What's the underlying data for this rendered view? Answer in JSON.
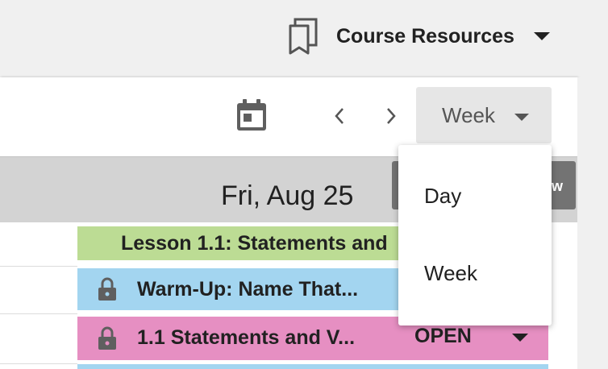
{
  "topbar": {
    "resources_label": "Course Resources",
    "resources_icon": "book-icon"
  },
  "toolbar": {
    "calendar_icon": "calendar-icon",
    "prev_icon": "chevron-left-icon",
    "next_icon": "chevron-right-icon",
    "view_select": {
      "selected": "Week"
    }
  },
  "view_menu": {
    "options": [
      "Day",
      "Week"
    ]
  },
  "day_header": {
    "title": "Fri, Aug 25",
    "button_text": "w"
  },
  "rows": [
    {
      "title": "Lesson 1.1: Statements and",
      "color": "#bcdc94"
    },
    {
      "title": "Warm-Up: Name That...",
      "locked": true,
      "color": "#a3d5f0"
    },
    {
      "title": "1.1 Statements and V...",
      "locked": true,
      "status": "OPEN",
      "color": "#e68fc2"
    }
  ],
  "colors": {
    "header_gray": "#d3d3d3",
    "select_bg": "#e6e6e6",
    "dark_button": "#737373"
  }
}
